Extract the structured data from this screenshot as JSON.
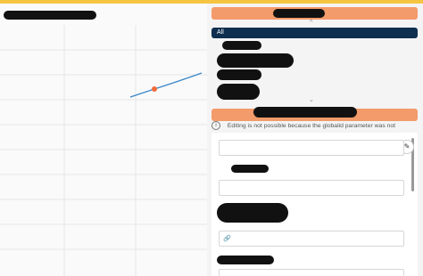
{
  "colors": {
    "top_bar": "#f5c542",
    "header_button": "#f39b6b",
    "filter_selected": "#0e2f4f",
    "chart_line": "#3a86c8",
    "chart_marker": "#f26b3a"
  },
  "panel": {
    "filter_all_label": "All",
    "notice_text": "Editing is not possible because the globalid parameter was not provided",
    "caret_up": "^",
    "caret_down": "⌄"
  },
  "icons": {
    "info": "info-icon",
    "edit": "pencil-icon",
    "link": "link-icon"
  }
}
